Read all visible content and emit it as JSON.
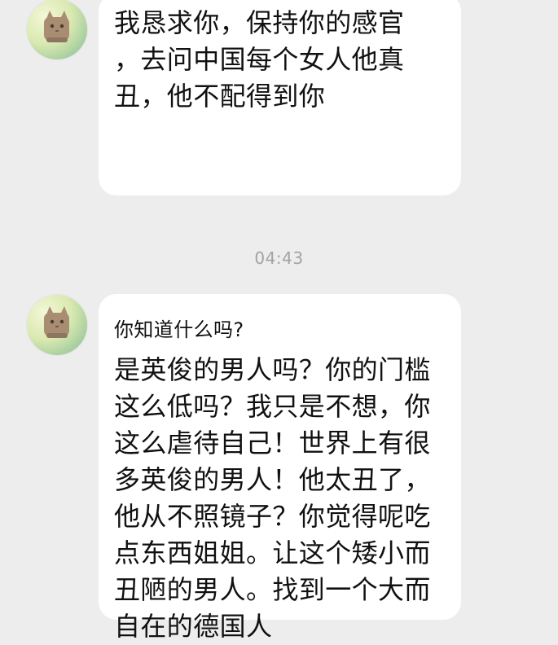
{
  "messages": [
    {
      "sender": "contact",
      "avatar_icon": "cat-avatar-icon",
      "lines": [
        "我恳求你，保持你的感官",
        "，去问中国每个女人他真",
        "丑，他不配得到你"
      ]
    },
    {
      "sender": "contact",
      "avatar_icon": "cat-avatar-icon",
      "header": "你知道什么吗?",
      "lines": [
        "是英俊的男人吗？你的门槛",
        "这么低吗？我只是不想，你",
        "这么虐待自己！世界上有很",
        "多英俊的男人！他太丑了，",
        "他从不照镜子？你觉得呢吃",
        "点东西姐姐。让这个矮小而",
        "丑陋的男人。找到一个大而",
        "自在的德国人"
      ]
    }
  ],
  "timestamp": "04:43",
  "colors": {
    "background": "#ededed",
    "bubble": "#ffffff",
    "text": "#111111",
    "timestamp": "#a3a3a3"
  }
}
